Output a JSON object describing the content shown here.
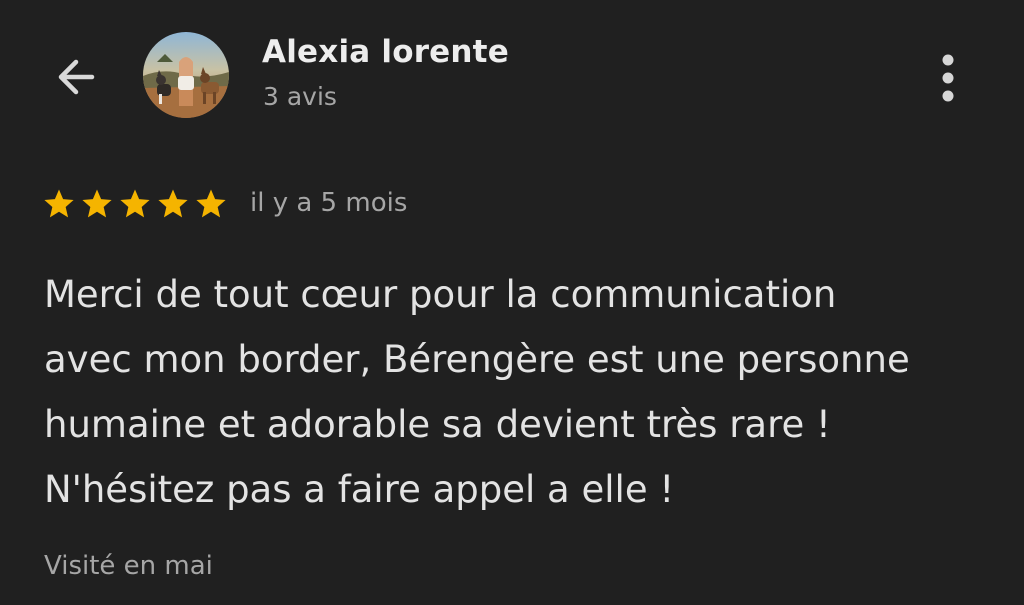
{
  "header": {
    "back_icon": "arrow-left-icon",
    "avatar_icon": "avatar-photo",
    "name": "Alexia lorente",
    "review_count": "3 avis",
    "more_icon": "more-vert-icon"
  },
  "review": {
    "rating": 5,
    "rating_max": 5,
    "star_color": "#f5b400",
    "date": "il y a 5 mois",
    "text_lines": [
      "Merci de tout cœur pour la communication",
      "avec mon border, Bérengère est une personne",
      "humaine et adorable sa devient très rare !",
      "N'hésitez pas a faire appel a elle !"
    ],
    "visit": "Visité en mai"
  },
  "colors": {
    "background": "#202020",
    "primary_text": "#e6e6e6",
    "secondary_text": "#a6a6a6"
  }
}
